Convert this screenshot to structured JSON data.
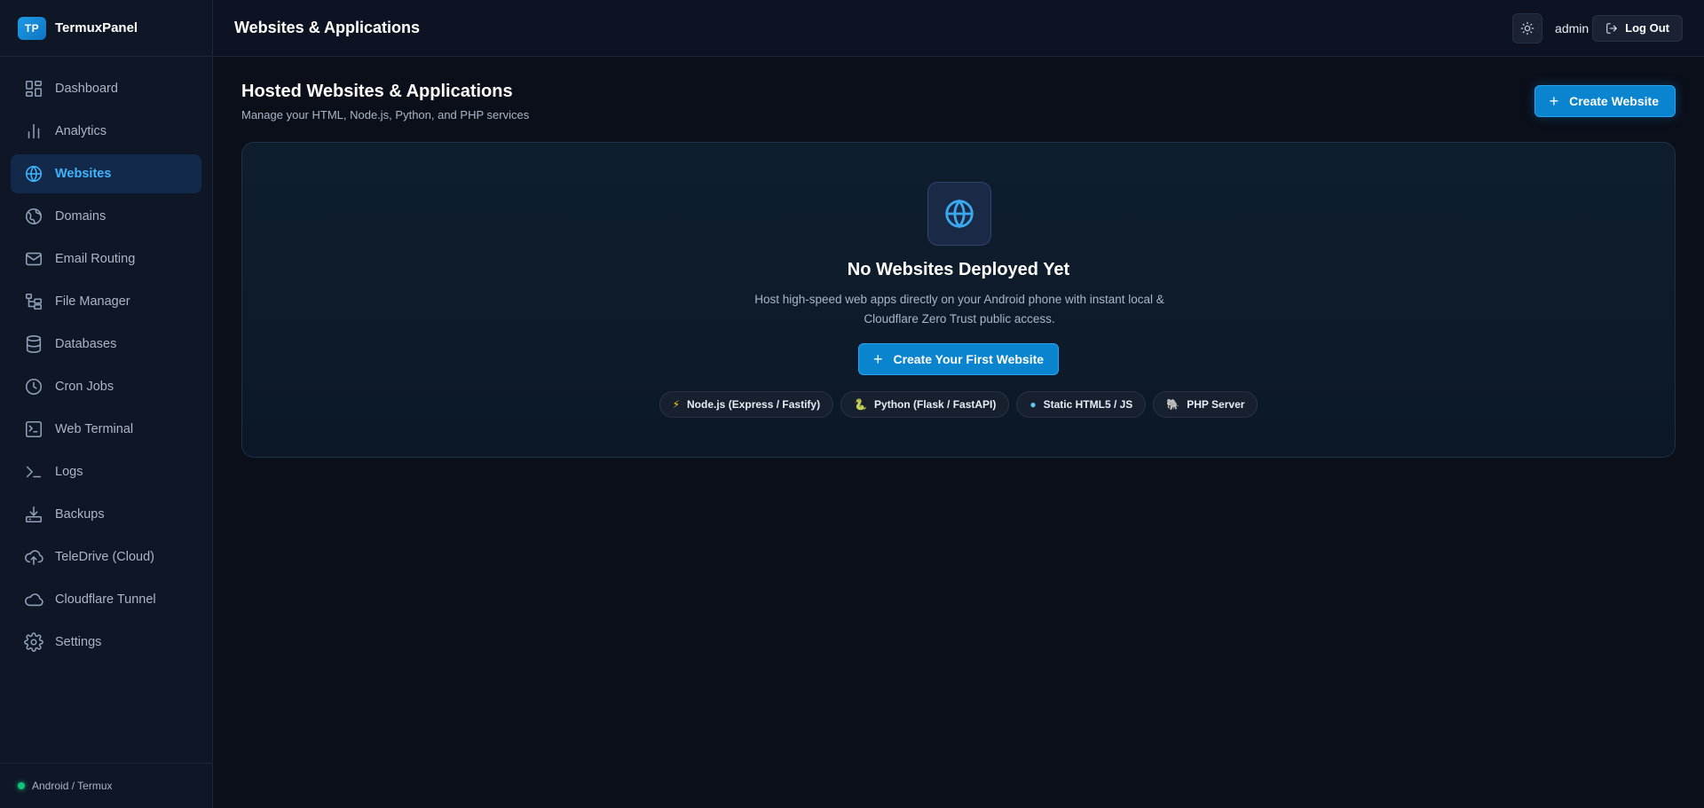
{
  "brand": {
    "logo": "TP",
    "name": "TermuxPanel"
  },
  "sidebar": {
    "items": [
      {
        "label": "Dashboard",
        "icon": "dashboard-icon"
      },
      {
        "label": "Analytics",
        "icon": "analytics-icon"
      },
      {
        "label": "Websites",
        "icon": "globe-icon",
        "active": true
      },
      {
        "label": "Domains",
        "icon": "domains-icon"
      },
      {
        "label": "Email Routing",
        "icon": "mail-icon"
      },
      {
        "label": "File Manager",
        "icon": "file-tree-icon"
      },
      {
        "label": "Databases",
        "icon": "database-icon"
      },
      {
        "label": "Cron Jobs",
        "icon": "clock-icon"
      },
      {
        "label": "Web Terminal",
        "icon": "terminal-window-icon"
      },
      {
        "label": "Logs",
        "icon": "prompt-icon"
      },
      {
        "label": "Backups",
        "icon": "download-icon"
      },
      {
        "label": "TeleDrive (Cloud)",
        "icon": "cloud-upload-icon"
      },
      {
        "label": "Cloudflare Tunnel",
        "icon": "cloud-icon"
      },
      {
        "label": "Settings",
        "icon": "gear-icon"
      }
    ],
    "footer": "Android / Termux"
  },
  "header": {
    "title": "Websites & Applications",
    "user": "admin",
    "logout_label": "Log Out"
  },
  "main": {
    "title": "Hosted Websites & Applications",
    "subtitle": "Manage your HTML, Node.js, Python, and PHP services",
    "create_button": "Create Website",
    "empty": {
      "title": "No Websites Deployed Yet",
      "description": "Host high-speed web apps directly on your Android phone with instant local & Cloudflare Zero Trust public access.",
      "button": "Create Your First Website",
      "chips": [
        {
          "icon": "⚡",
          "label": "Node.js (Express / Fastify)"
        },
        {
          "icon": "🐍",
          "label": "Python (Flask / FastAPI)"
        },
        {
          "icon": "●",
          "label": "Static HTML5 / JS"
        },
        {
          "icon": "🐘",
          "label": "PHP Server"
        }
      ]
    }
  },
  "colors": {
    "accent": "#0b84d0",
    "active_text": "#3fb4ff",
    "background": "#0b0f1a",
    "status_online": "#10c27a"
  }
}
